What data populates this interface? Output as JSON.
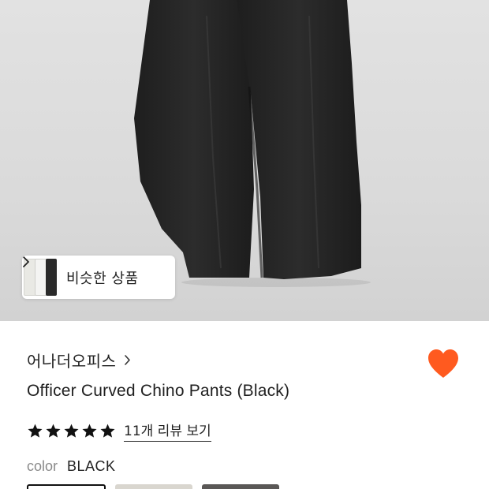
{
  "similar_products": {
    "label": "비슷한 상품"
  },
  "brand": {
    "name": "어나더오피스"
  },
  "product": {
    "title": "Officer Curved Chino Pants (Black)"
  },
  "rating": {
    "stars": 5,
    "review_link": "11개 리뷰 보기"
  },
  "color": {
    "label": "color",
    "value": "BLACK"
  },
  "colors": {
    "heart": "#FF5A1F",
    "background": "#FFFFFF",
    "text": "#1F1F1F"
  },
  "icons": [
    "chevron-right-icon",
    "heart-icon",
    "star-icon"
  ]
}
